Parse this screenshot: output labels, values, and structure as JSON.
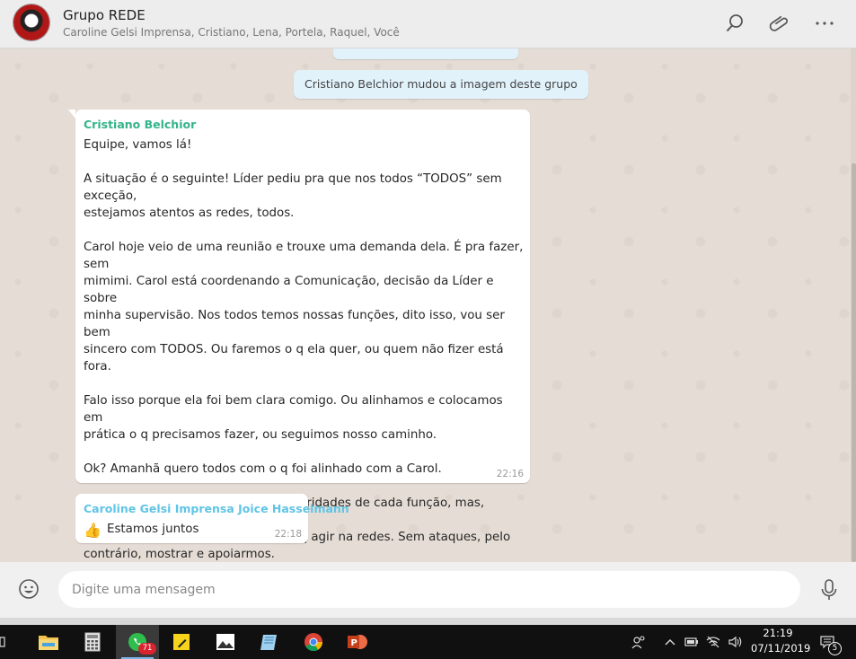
{
  "header": {
    "title": "Grupo REDE",
    "members": "Caroline Gelsi Imprensa, Cristiano, Lena, Portela, Raquel, Você"
  },
  "chat": {
    "system_message": "Cristiano Belchior mudou a imagem deste grupo",
    "messages": [
      {
        "sender": "Cristiano Belchior",
        "sender_color": "#35b38a",
        "text": "Equipe, vamos lá!\n\nA situação é o seguinte! Líder pediu pra que nos todos “TODOS” sem exceção,\nestejamos atentos as redes, todos.\n\nCarol hoje veio de uma reunião e trouxe uma demanda dela. É pra fazer, sem\nmimimi. Carol está coordenando a Comunicação, decisão da Líder e sobre\nminha supervisão. Nos todos temos nossas funções, dito isso, vou ser bem\nsincero com TODOS. Ou faremos o q ela quer, ou quem não fizer está fora.\n\nFalo isso porque ela foi bem clara comigo. Ou alinhamos e colocamos em\nprática o q precisamos fazer, ou seguimos nosso caminho.\n\nOk? Amanhã quero todos com o q foi alinhado com a Carol.\n\nNão é pra deixarmos de fazer as prioridades de cada função, mas, quando\nformos acionados pela Carol temos q agir na redes. Sem ataques, pelo\ncontrário, mostrar e apoiarmos.\n\nBoa noite! E fiquem susegados que vamos vencer.",
        "time": "22:16"
      },
      {
        "sender": "Caroline Gelsi Imprensa Joice Hasselmann",
        "sender_color": "#5fc4e6",
        "emoji": "👍",
        "text": "Estamos juntos",
        "time": "22:18"
      }
    ]
  },
  "composer": {
    "placeholder": "Digite uma mensagem"
  },
  "taskbar": {
    "whatsapp_badge": "71",
    "clock_time": "21:19",
    "clock_date": "07/11/2019",
    "notification_count": "5"
  },
  "icons": {
    "header": [
      "search-icon",
      "paperclip-icon",
      "more-options-icon"
    ],
    "composer": [
      "emoji-icon",
      "microphone-icon"
    ],
    "taskbar": [
      "task-view-icon",
      "file-explorer-icon",
      "calculator-icon",
      "whatsapp-icon",
      "sticky-notes-icon",
      "photos-icon",
      "notepad-icon",
      "chrome-icon",
      "powerpoint-icon"
    ],
    "tray": [
      "people-icon",
      "chevron-up-icon",
      "battery-icon",
      "network-icon",
      "volume-icon",
      "action-center-icon"
    ]
  }
}
